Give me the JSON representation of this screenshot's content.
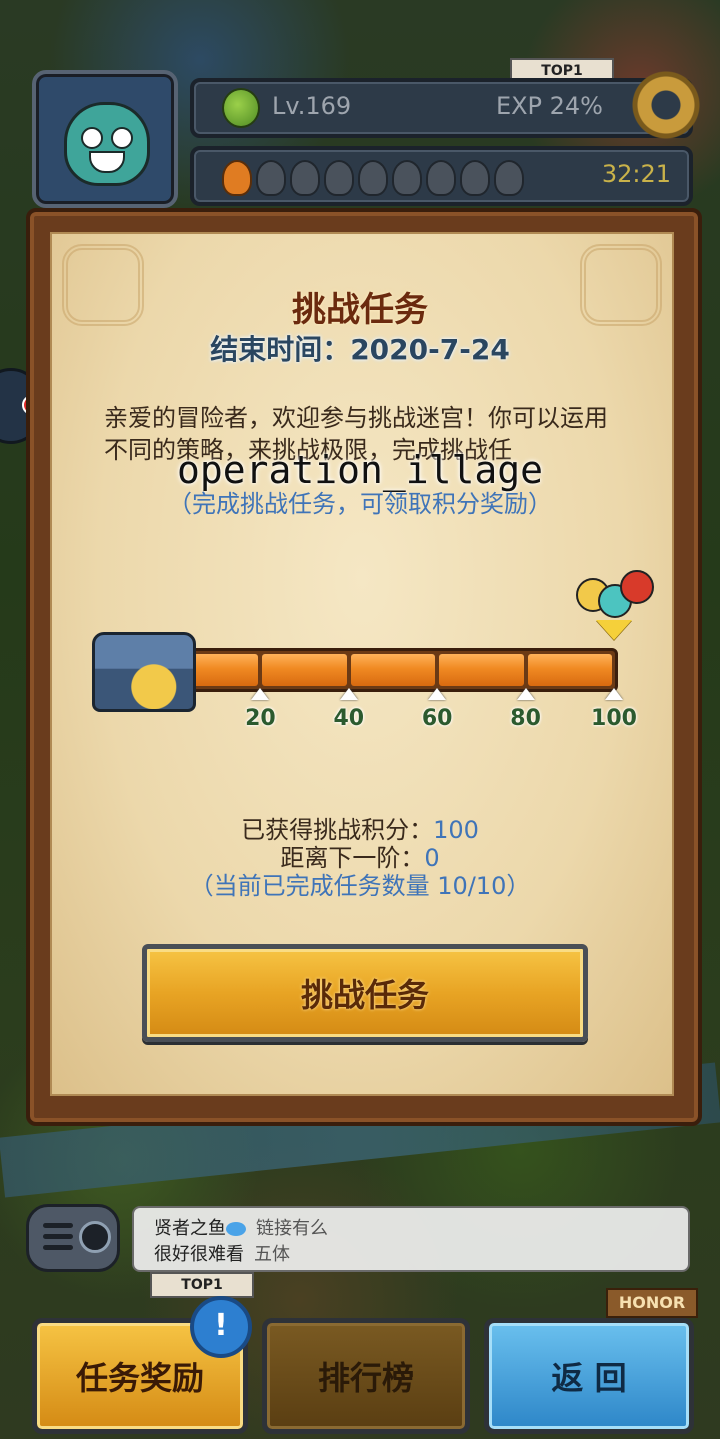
{
  "hud": {
    "level": "Lv.169",
    "exp": "EXP 24%",
    "stamina_timer": "32:21",
    "stamina_full": 1,
    "stamina_total": 9
  },
  "dialog": {
    "title": "挑战任务",
    "end_time": "结束时间：2020-7-24",
    "description": "亲爱的冒险者，欢迎参与挑战迷宫！你可以运用不同的策略，来挑战极限，完成挑战任",
    "watermark": "operation_illage",
    "hint": "（完成挑战任务，可领取积分奖励）",
    "progress": {
      "value": 100,
      "max": 100,
      "ticks": [
        "20",
        "40",
        "60",
        "80",
        "100"
      ]
    },
    "score_label": "已获得挑战积分：",
    "score_value": "100",
    "next_label": "距离下一阶：",
    "next_value": "0",
    "tasks_done": "（当前已完成任务数量 10/10）",
    "main_button": "挑战任务"
  },
  "chat": {
    "line1_user": "贤者之鱼",
    "line1_msg": "链接有么",
    "line2_user": "很好很难看",
    "line2_msg": "五体"
  },
  "bottom": {
    "reward": "任务奖励",
    "rank": "排行榜",
    "back": "返 回",
    "badge": "!"
  },
  "map_signs": {
    "honor": "HONOR",
    "top1": "TOP1",
    "top2": "TOP1"
  },
  "colors": {
    "title": "#6b2a0e",
    "accent_blue": "#3f74b8",
    "progress_fill": "#f08a22"
  }
}
